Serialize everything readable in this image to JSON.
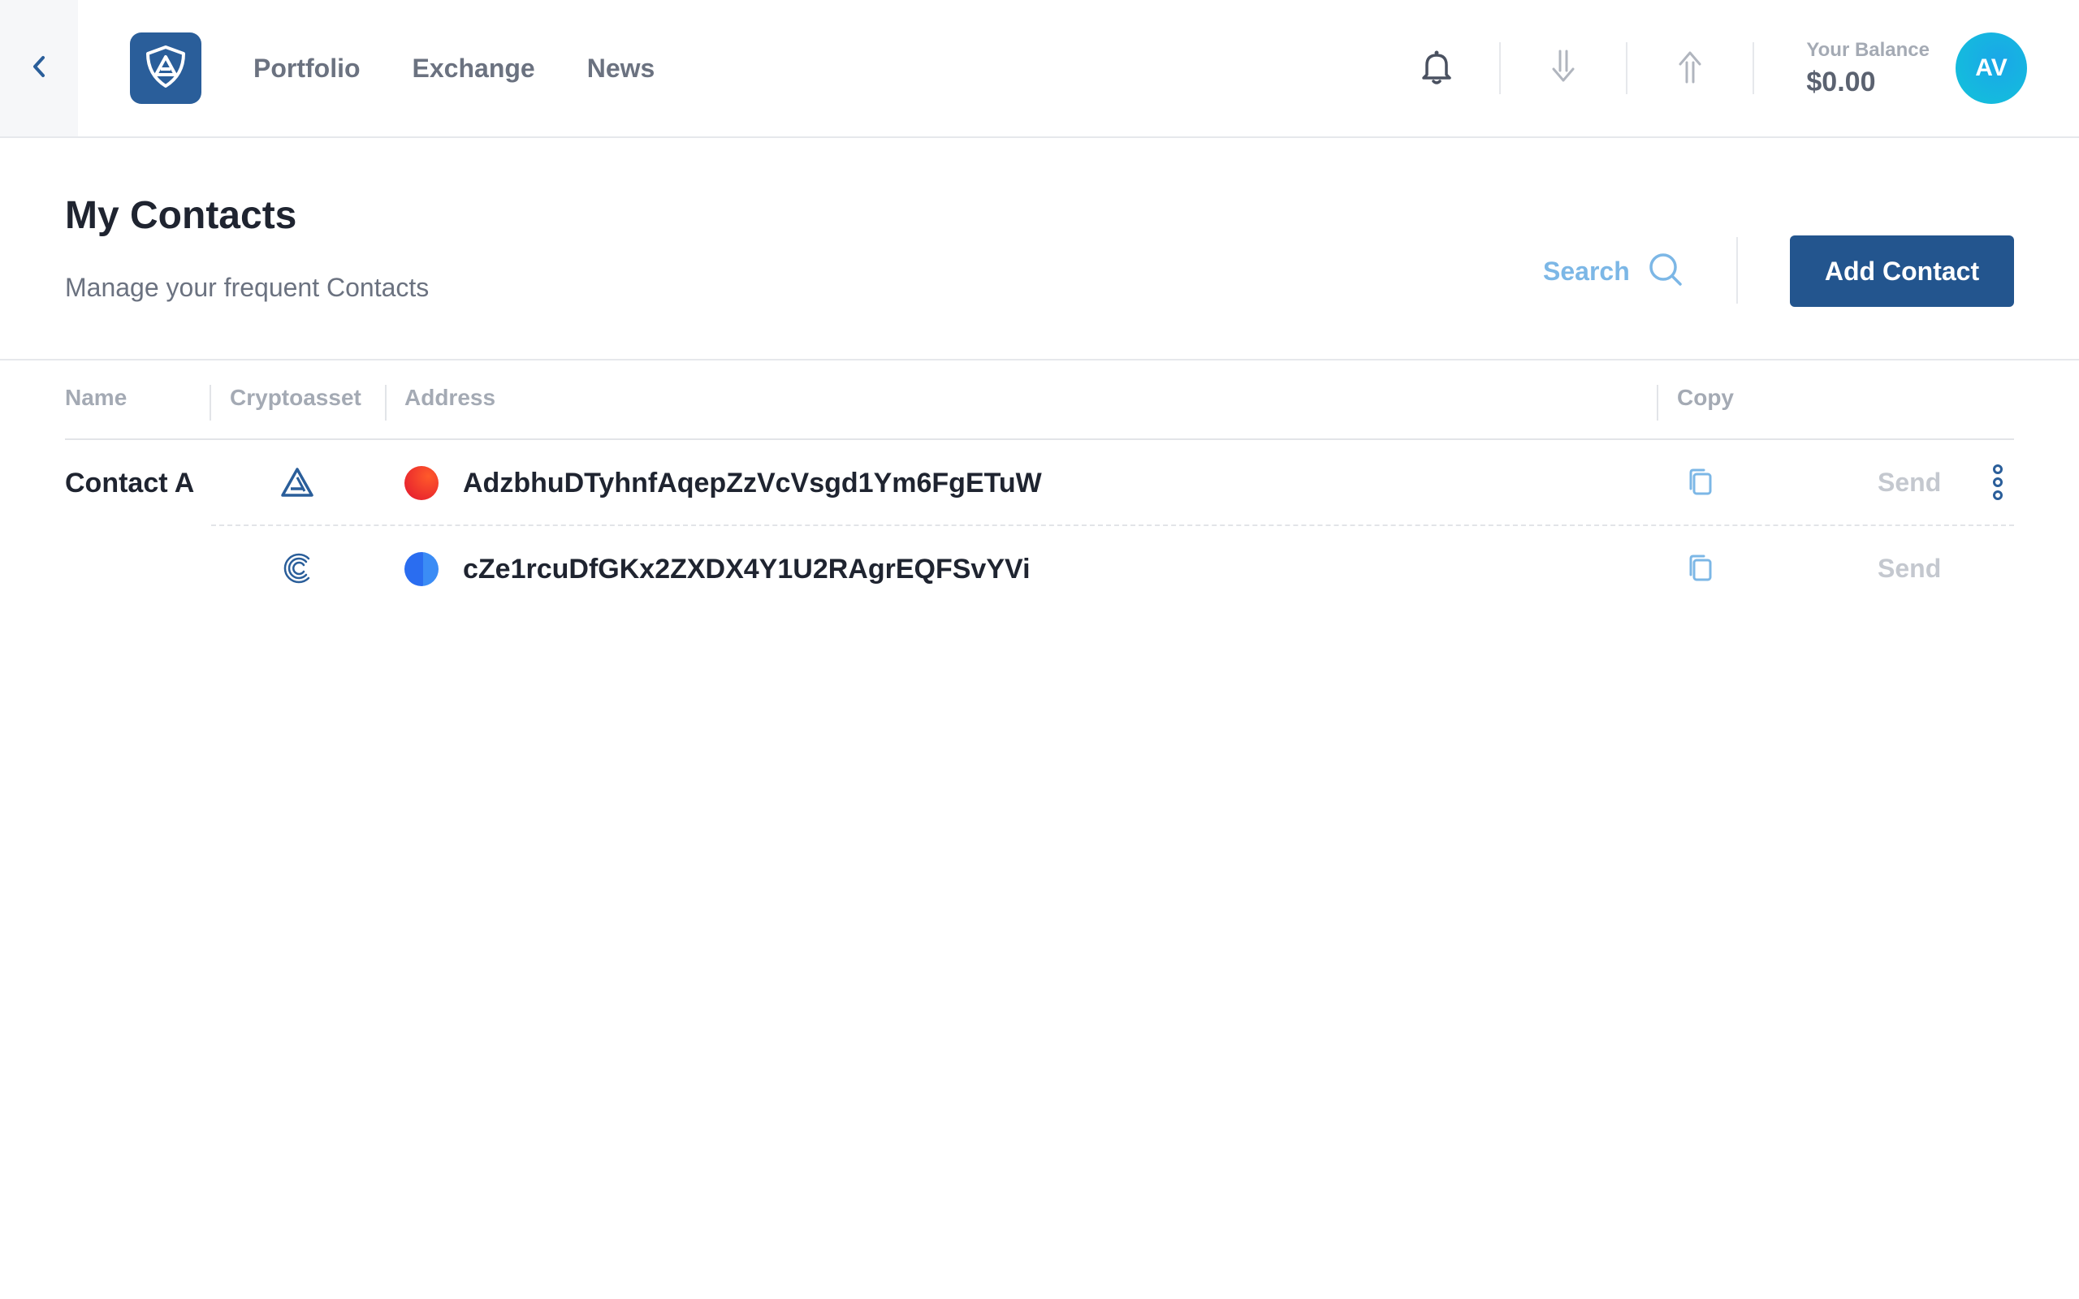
{
  "nav": {
    "links": [
      {
        "label": "Portfolio"
      },
      {
        "label": "Exchange"
      },
      {
        "label": "News"
      }
    ],
    "balance_label": "Your Balance",
    "balance_value": "$0.00",
    "avatar_initials": "AV"
  },
  "header": {
    "title": "My Contacts",
    "subtitle": "Manage your frequent Contacts",
    "search_label": "Search",
    "add_button": "Add Contact"
  },
  "table": {
    "columns": {
      "name": "Name",
      "cryptoasset": "Cryptoasset",
      "address": "Address",
      "copy": "Copy"
    },
    "rows": [
      {
        "name": "Contact A",
        "asset_icon": "ark-icon",
        "network_color": "#f0312a",
        "address": "AdzbhuDTyhnfAqepZzVcVsgd1Ym6FgETuW",
        "send": "Send"
      },
      {
        "name": "",
        "asset_icon": "compendia-icon",
        "network_color": "#2a6df0",
        "address": "cZe1rcuDfGKx2ZXDX4Y1U2RAgrEQFSvYVi",
        "send": "Send"
      }
    ]
  },
  "colors": {
    "primary": "#23558e",
    "accent_light": "#7cb7e6",
    "avatar": "#12b5e0"
  }
}
